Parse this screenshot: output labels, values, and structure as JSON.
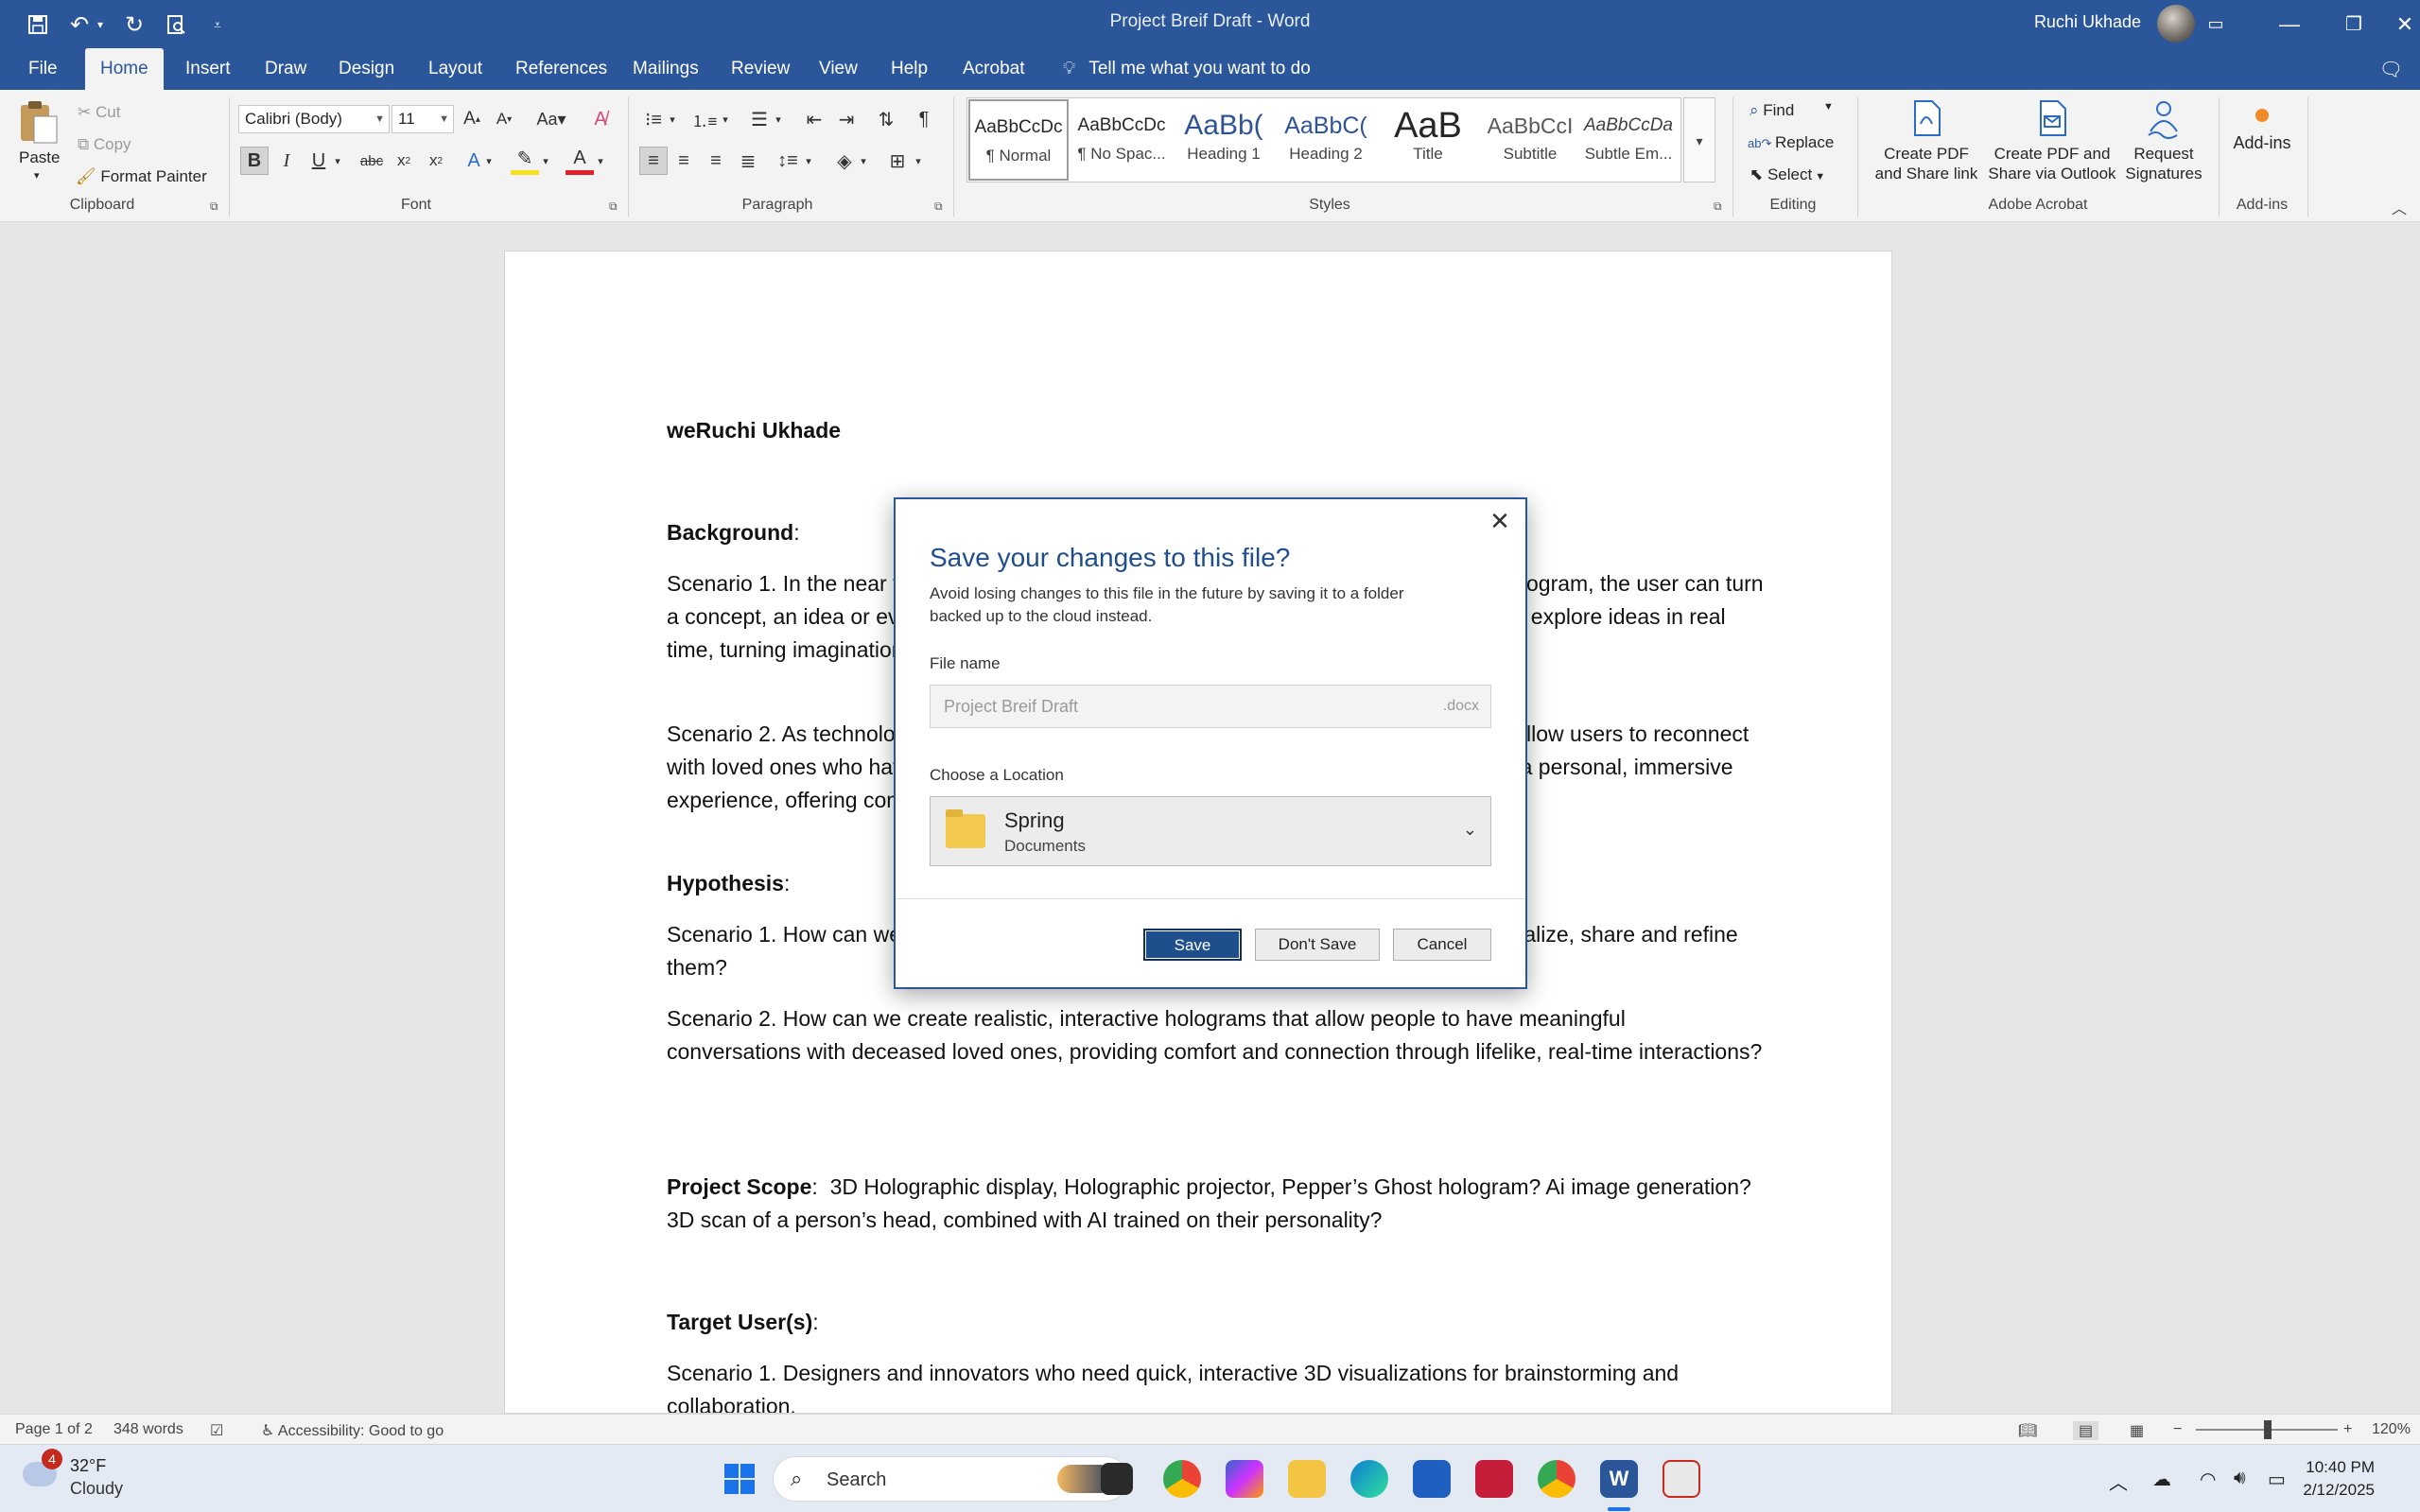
{
  "titlebar": {
    "title": "Project Breif Draft  -  Word",
    "user_name": "Ruchi Ukhade"
  },
  "tabs": [
    "File",
    "Home",
    "Insert",
    "Draw",
    "Design",
    "Layout",
    "References",
    "Mailings",
    "Review",
    "View",
    "Help",
    "Acrobat"
  ],
  "active_tab": "Home",
  "tell_me": "Tell me what you want to do",
  "ribbon": {
    "clipboard": {
      "paste": "Paste",
      "cut": "Cut",
      "copy": "Copy",
      "format_painter": "Format Painter",
      "label": "Clipboard"
    },
    "font": {
      "family": "Calibri (Body)",
      "size": "11",
      "label": "Font"
    },
    "paragraph": {
      "label": "Paragraph"
    },
    "styles": {
      "label": "Styles",
      "items": [
        {
          "preview": "AaBbCcDc",
          "name": "¶ Normal"
        },
        {
          "preview": "AaBbCcDc",
          "name": "¶ No Spac..."
        },
        {
          "preview": "AaBb(",
          "name": "Heading 1"
        },
        {
          "preview": "AaBbC(",
          "name": "Heading 2"
        },
        {
          "preview": "AaB",
          "name": "Title"
        },
        {
          "preview": "AaBbCcI",
          "name": "Subtitle"
        },
        {
          "preview": "AaBbCcDa",
          "name": "Subtle Em..."
        }
      ]
    },
    "editing": {
      "find": "Find",
      "replace": "Replace",
      "select": "Select",
      "label": "Editing"
    },
    "acrobat": {
      "create_pdf": [
        "Create PDF",
        "and Share link"
      ],
      "create_pdf_outlook": [
        "Create PDF and",
        "Share via Outlook"
      ],
      "request_signatures": [
        "Request",
        "Signatures"
      ],
      "label": "Adobe Acrobat"
    },
    "addins": {
      "button": "Add-ins",
      "label": "Add-ins"
    }
  },
  "document": {
    "author": "weRuchi Ukhade",
    "background_heading": "Background",
    "bg_s1": "Scenario 1. In the near future, sketching ideas is brought to life. With a small, portable hologram, the user can turn a concept, an idea or even a rough sketch of a plan. These holograms let people see and explore ideas in real time, turning imagination into reality.",
    "bg_s2": "Scenario 2. As technology advances, holograms do too. Small, portable holograms now allow users to reconnect with loved ones who have passed, capturing their voice, mannerisms and personality for a personal, immersive experience, offering comfort.",
    "hypothesis_heading": "Hypothesis",
    "hyp_s1": "Scenario 1. How can we turn ideas into interactive 3D holograms, making it easier to visualize, share and refine them?",
    "hyp_s2": "Scenario 2. How can we create realistic, interactive holograms that allow people to have meaningful conversations with deceased loved ones, providing comfort and connection through lifelike, real-time interactions?",
    "scope_heading": "Project Scope",
    "scope_text": "3D Holographic display, Holographic projector, Pepper’s Ghost hologram? Ai image generation? 3D scan of a person’s head, combined with AI trained on their personality?",
    "target_heading": "Target User(s)",
    "target_s1": "Scenario 1. Designers and innovators who need quick, interactive 3D visualizations for brainstorming and collaboration."
  },
  "dialog": {
    "title": "Save your changes to this file?",
    "description": "Avoid losing changes to this file in the future by saving it to a folder backed up to the cloud instead.",
    "file_name_label": "File name",
    "file_name_value": "Project Breif Draft",
    "file_ext": ".docx",
    "location_label": "Choose a Location",
    "location_name": "Spring",
    "location_sub": "Documents",
    "save": "Save",
    "dont_save": "Don't Save",
    "cancel": "Cancel"
  },
  "statusbar": {
    "page": "Page 1 of 2",
    "words": "348 words",
    "accessibility": "Accessibility: Good to go",
    "zoom": "120%"
  },
  "taskbar": {
    "weather_temp": "32°F",
    "weather_cond": "Cloudy",
    "weather_badge": "4",
    "search": "Search",
    "time": "10:40 PM",
    "date": "2/12/2025"
  }
}
